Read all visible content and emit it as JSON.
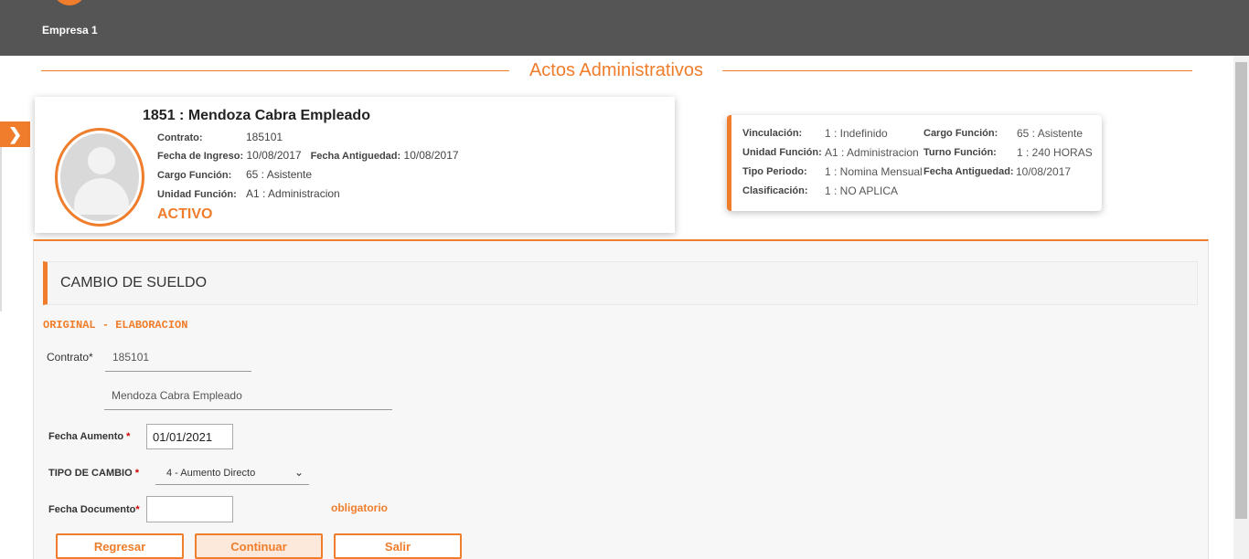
{
  "header": {
    "company": "Empresa 1"
  },
  "page": {
    "title": "Actos Administrativos"
  },
  "employee": {
    "name": "1851 : Mendoza Cabra Empleado",
    "contrato_label": "Contrato:",
    "contrato": "185101",
    "fecha_ingreso_label": "Fecha de Ingreso:",
    "fecha_ingreso": "10/08/2017",
    "fecha_antiguedad_label": "Fecha Antiguedad:",
    "fecha_antiguedad": "10/08/2017",
    "cargo_label": "Cargo Función:",
    "cargo": "65 : Asistente",
    "unidad_label": "Unidad Función:",
    "unidad": "A1 : Administracion",
    "status": "ACTIVO"
  },
  "info": {
    "vinculacion_label": "Vinculación:",
    "vinculacion": "1 : Indefinido",
    "unidad_label": "Unidad Función:",
    "unidad": "A1 : Administracion",
    "tipo_periodo_label": "Tipo Periodo:",
    "tipo_periodo": "1 : Nomina Mensual",
    "clasificacion_label": "Clasificación:",
    "clasificacion": "1 : NO APLICA",
    "cargo_label": "Cargo Función:",
    "cargo": "65 : Asistente",
    "turno_label": "Turno Función:",
    "turno": "1 : 240 HORAS",
    "fecha_antiguedad_label": "Fecha Antiguedad:",
    "fecha_antiguedad": "10/08/2017"
  },
  "section": {
    "title": "CAMBIO DE SUELDO",
    "doc_status": "ORIGINAL - ELABORACION"
  },
  "form": {
    "contrato_label": "Contrato*",
    "contrato_value": "185101",
    "empleado_value": "Mendoza Cabra Empleado",
    "fecha_aumento_label": "Fecha Aumento",
    "fecha_aumento_value": "01/01/2021",
    "tipo_cambio_label": "TIPO DE CAMBIO",
    "tipo_cambio_value": "4 - Aumento Directo",
    "fecha_documento_label": "Fecha Documento",
    "fecha_documento_value": "",
    "required_mark": "*",
    "obligatorio": "obligatorio"
  },
  "buttons": {
    "regresar": "Regresar",
    "continuar": "Continuar",
    "salir": "Salir"
  },
  "colors": {
    "accent": "#ef7d2b",
    "topbar": "#555555"
  }
}
